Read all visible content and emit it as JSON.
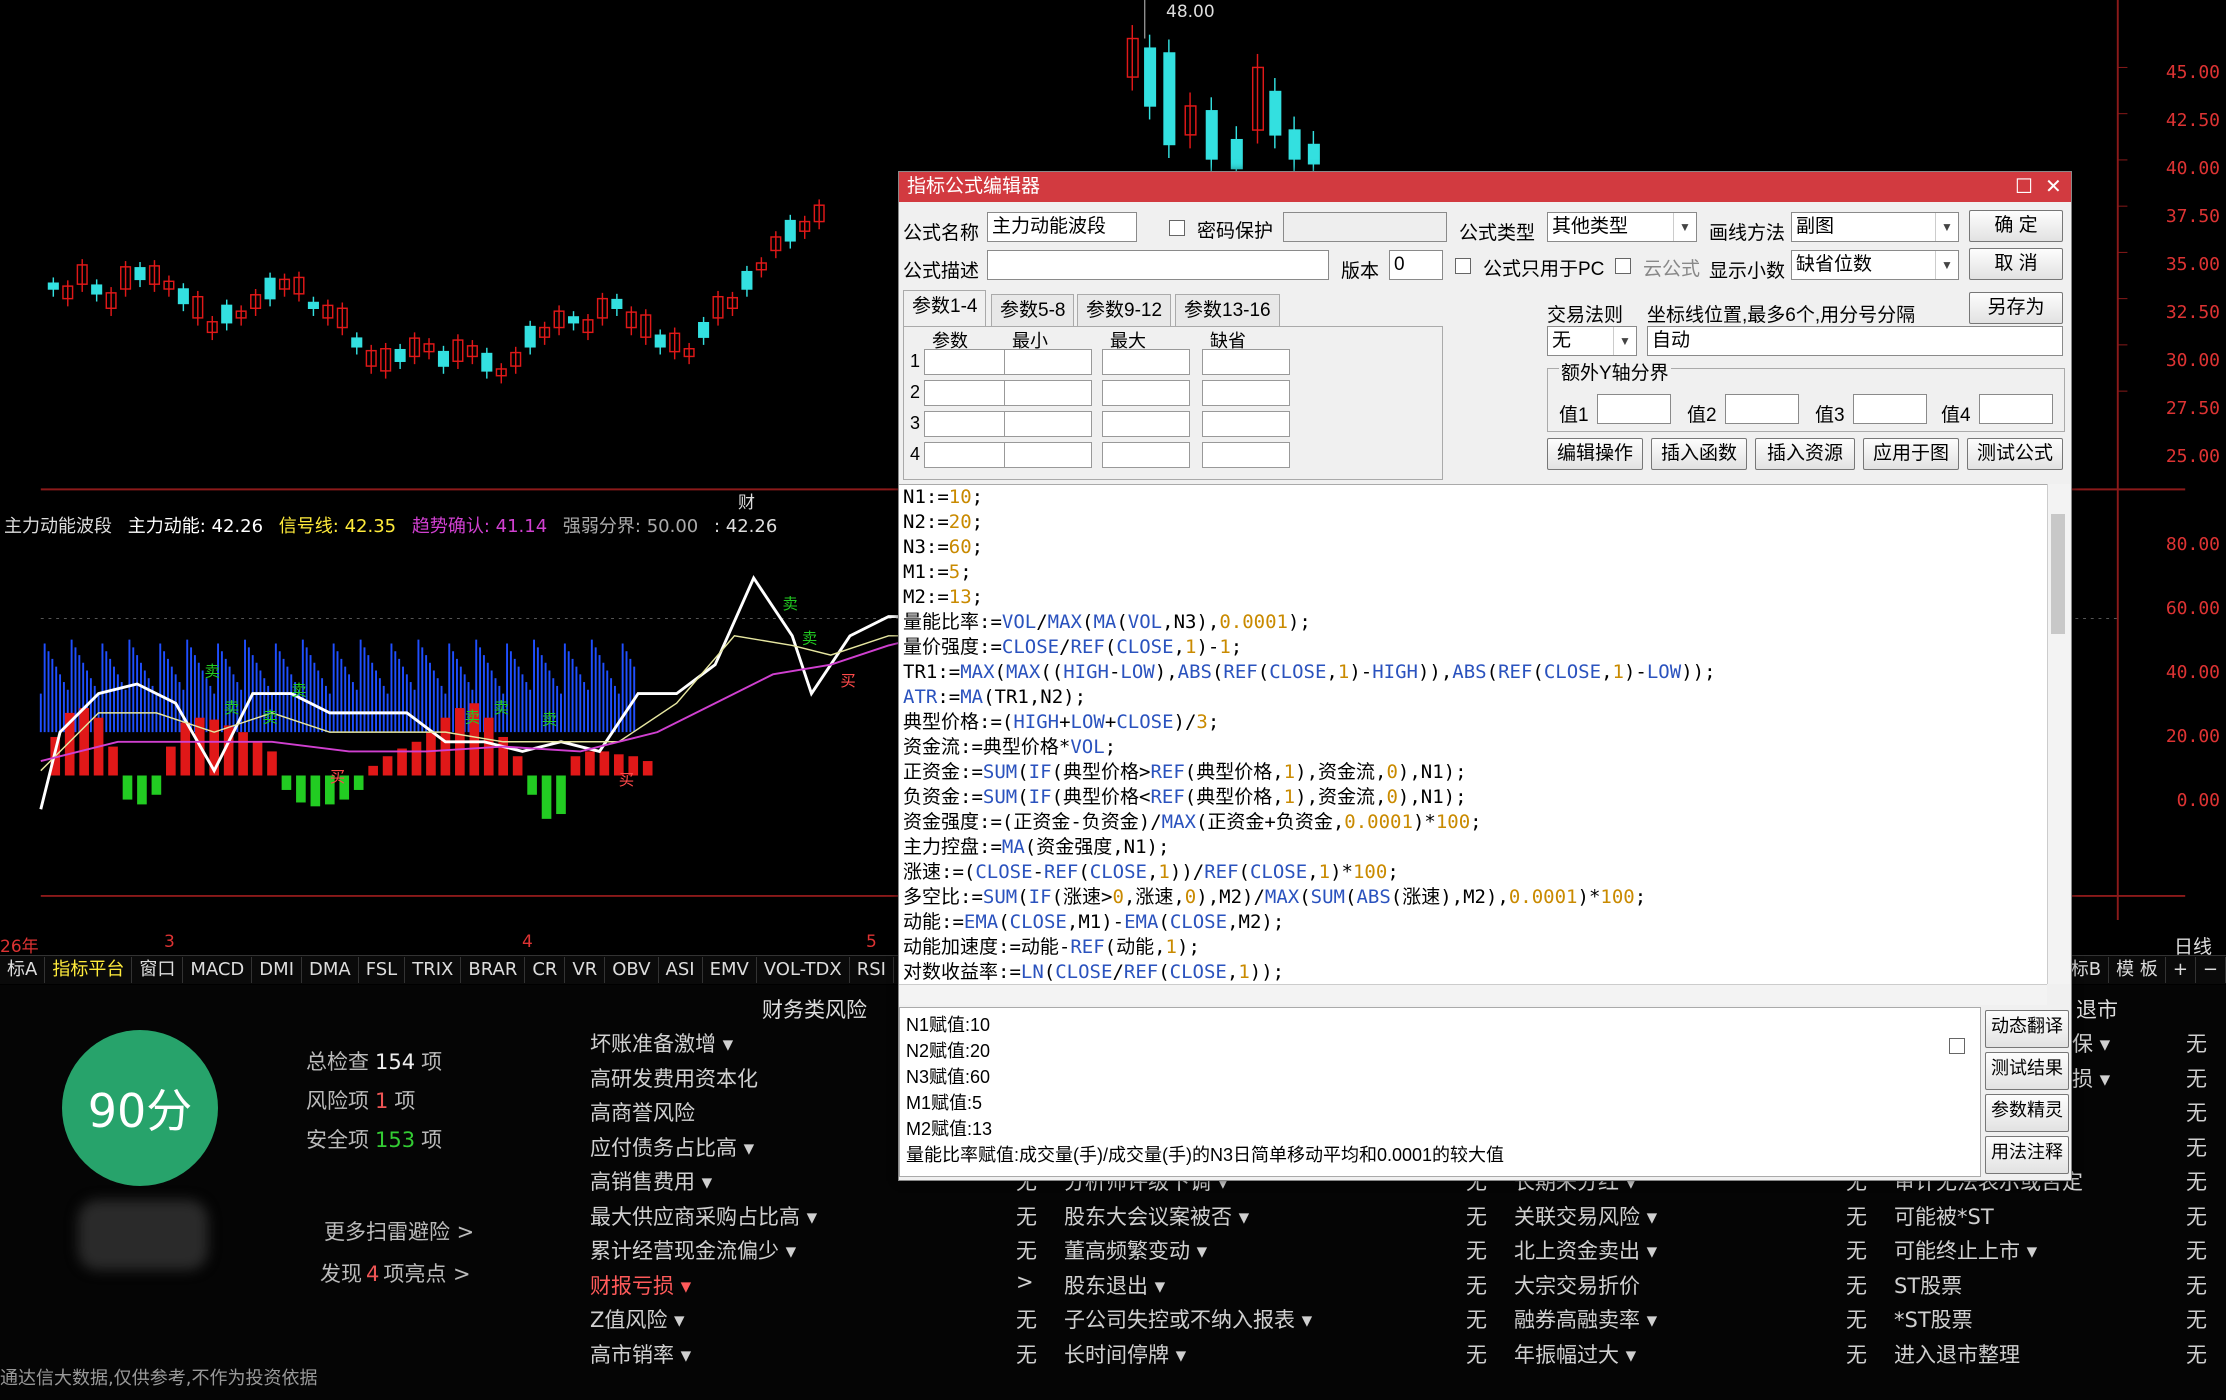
{
  "main_chart": {
    "peak_label": "48.00",
    "price_axis": [
      "45.00",
      "42.50",
      "40.00",
      "37.50",
      "35.00",
      "32.50",
      "30.00",
      "27.50",
      "25.00"
    ],
    "ind_axis": [
      "80.00",
      "60.00",
      "40.00",
      "20.00",
      "0.00"
    ],
    "fin_marker": "财",
    "date_labels": [
      "26年",
      "3",
      "4",
      "5"
    ],
    "period": "日线",
    "indicator_title": {
      "name": "主力动能波段",
      "main": "主力动能: 42.26",
      "signal": "信号线: 42.35",
      "trend": "趋势确认: 41.14",
      "boundary": "强弱分界: 50.00",
      "extra": ": 42.26"
    },
    "sell_label": "卖",
    "buy_label": "买",
    "colors": {
      "red": "#e01818",
      "cyan": "#33e0e0",
      "green": "#22cc22",
      "blue": "#1f4fff"
    }
  },
  "tabs": [
    "标A",
    "指标平台",
    "窗口",
    "MACD",
    "DMI",
    "DMA",
    "FSL",
    "TRIX",
    "BRAR",
    "CR",
    "VR",
    "OBV",
    "ASI",
    "EMV",
    "VOL-TDX",
    "RSI",
    "WR"
  ],
  "tabs_right": [
    "标B",
    "模 板",
    "+",
    "−"
  ],
  "risk": {
    "score": "90分",
    "total_label": "总检查",
    "total_value": "154",
    "total_unit": "项",
    "risk_label": "风险项",
    "risk_value": "1",
    "risk_unit": "项",
    "safe_label": "安全项",
    "safe_value": "153",
    "safe_unit": "项",
    "more": "更多扫雷避险 >",
    "highlight_pre": "发现",
    "highlight_num": "4",
    "highlight_post": "项亮点 >",
    "disclaimer": "通达信大数据,仅供参考,不作为投资依据",
    "header_fin": "财务类风险",
    "header_delist": "退市",
    "col1": [
      {
        "label": "坏账准备激增 ▾",
        "value": ""
      },
      {
        "label": "高研发费用资本化",
        "value": ""
      },
      {
        "label": "高商誉风险",
        "value": ""
      },
      {
        "label": "应付债务占比高 ▾",
        "value": ""
      },
      {
        "label": "高销售费用 ▾",
        "value": "无"
      },
      {
        "label": "最大供应商采购占比高 ▾",
        "value": "无"
      },
      {
        "label": "累计经营现金流偏少 ▾",
        "value": "无"
      },
      {
        "label": "财报亏损 ▾",
        "value": ">"
      },
      {
        "label": "Z值风险 ▾",
        "value": "无"
      },
      {
        "label": "高市销率 ▾",
        "value": "无"
      }
    ],
    "col2": [
      {
        "label": "分析师评级下调 ▾",
        "value": "无"
      },
      {
        "label": "股东大会议案被否 ▾",
        "value": "无"
      },
      {
        "label": "董高频繁变动 ▾",
        "value": "无"
      },
      {
        "label": "股东退出 ▾",
        "value": "无"
      },
      {
        "label": "子公司失控或不纳入报表 ▾",
        "value": "无"
      },
      {
        "label": "长时间停牌 ▾",
        "value": "无"
      }
    ],
    "col3": [
      {
        "label": "长期未分红 ▾",
        "value": "无"
      },
      {
        "label": "关联交易风险 ▾",
        "value": "无"
      },
      {
        "label": "北上资金卖出 ▾",
        "value": "无"
      },
      {
        "label": "大宗交易折价",
        "value": "无"
      },
      {
        "label": "融券高融卖率 ▾",
        "value": "无"
      },
      {
        "label": "年振幅过大 ▾",
        "value": "无"
      }
    ],
    "col4_top": [
      {
        "label": "保 ▾",
        "value": "无"
      },
      {
        "label": "损 ▾",
        "value": "无"
      },
      {
        "label": "",
        "value": "无"
      },
      {
        "label": "",
        "value": "无"
      }
    ],
    "col4": [
      {
        "label": "审计无法表示或否定",
        "value": "无"
      },
      {
        "label": "可能被*ST",
        "value": "无"
      },
      {
        "label": "可能终止上市 ▾",
        "value": "无"
      },
      {
        "label": "ST股票",
        "value": "无"
      },
      {
        "label": "*ST股票",
        "value": "无"
      },
      {
        "label": "进入退市整理",
        "value": "无"
      }
    ]
  },
  "dialog": {
    "title": "指标公式编辑器",
    "name_label": "公式名称",
    "name_value": "主力动能波段",
    "pwd_label": "密码保护",
    "type_label": "公式类型",
    "type_value": "其他类型",
    "draw_label": "画线方法",
    "draw_value": "副图",
    "ok": "确  定",
    "cancel": "取  消",
    "saveas": "另存为",
    "desc_label": "公式描述",
    "version_label": "版本",
    "version_value": "0",
    "pc_only": "公式只用于PC",
    "cloud": "云公式",
    "decimals_label": "显示小数",
    "decimals_value": "缺省位数",
    "param_tabs": [
      "参数1-4",
      "参数5-8",
      "参数9-12",
      "参数13-16"
    ],
    "param_headers": [
      "参数",
      "最小",
      "最大",
      "缺省"
    ],
    "param_rows": [
      "1",
      "2",
      "3",
      "4"
    ],
    "trade_label": "交易法则",
    "trade_value": "无",
    "coord_label": "坐标线位置,最多6个,用分号分隔",
    "coord_value": "自动",
    "yaxis_label": "额外Y轴分界",
    "y1": "值1",
    "y2": "值2",
    "y3": "值3",
    "y4": "值4",
    "btn_edit": "编辑操作",
    "btn_func": "插入函数",
    "btn_res": "插入资源",
    "btn_apply": "应用于图",
    "btn_test": "测试公式",
    "code": [
      "N1:=10;",
      "N2:=20;",
      "N3:=60;",
      "M1:=5;",
      "M2:=13;",
      "量能比率:=VOL/MAX(MA(VOL,N3),0.0001);",
      "量价强度:=CLOSE/REF(CLOSE,1)-1;",
      "TR1:=MAX(MAX((HIGH-LOW),ABS(REF(CLOSE,1)-HIGH)),ABS(REF(CLOSE,1)-LOW));",
      "ATR:=MA(TR1,N2);",
      "典型价格:=(HIGH+LOW+CLOSE)/3;",
      "资金流:=典型价格*VOL;",
      "正资金:=SUM(IF(典型价格>REF(典型价格,1),资金流,0),N1);",
      "负资金:=SUM(IF(典型价格<REF(典型价格,1),资金流,0),N1);",
      "资金强度:=(正资金-负资金)/MAX(正资金+负资金,0.0001)*100;",
      "主力控盘:=MA(资金强度,N1);",
      "涨速:=(CLOSE-REF(CLOSE,1))/REF(CLOSE,1)*100;",
      "多空比:=SUM(IF(涨速>0,涨速,0),M2)/MAX(SUM(ABS(涨速),M2),0.0001)*100;",
      "动能:=EMA(CLOSE,M1)-EMA(CLOSE,M2);",
      "动能加速度:=动能-REF(动能,1);",
      "对数收益率:=LN(CLOSE/REF(CLOSE,1));"
    ],
    "messages": [
      "N1赋值:10",
      "N2赋值:20",
      "N3赋值:60",
      "M1赋值:5",
      "M2赋值:13",
      "量能比率赋值:成交量(手)/成交量(手)的N3日简单移动平均和0.0001的较大值"
    ],
    "side_buttons": [
      "动态翻译",
      "测试结果",
      "参数精灵",
      "用法注释"
    ]
  }
}
